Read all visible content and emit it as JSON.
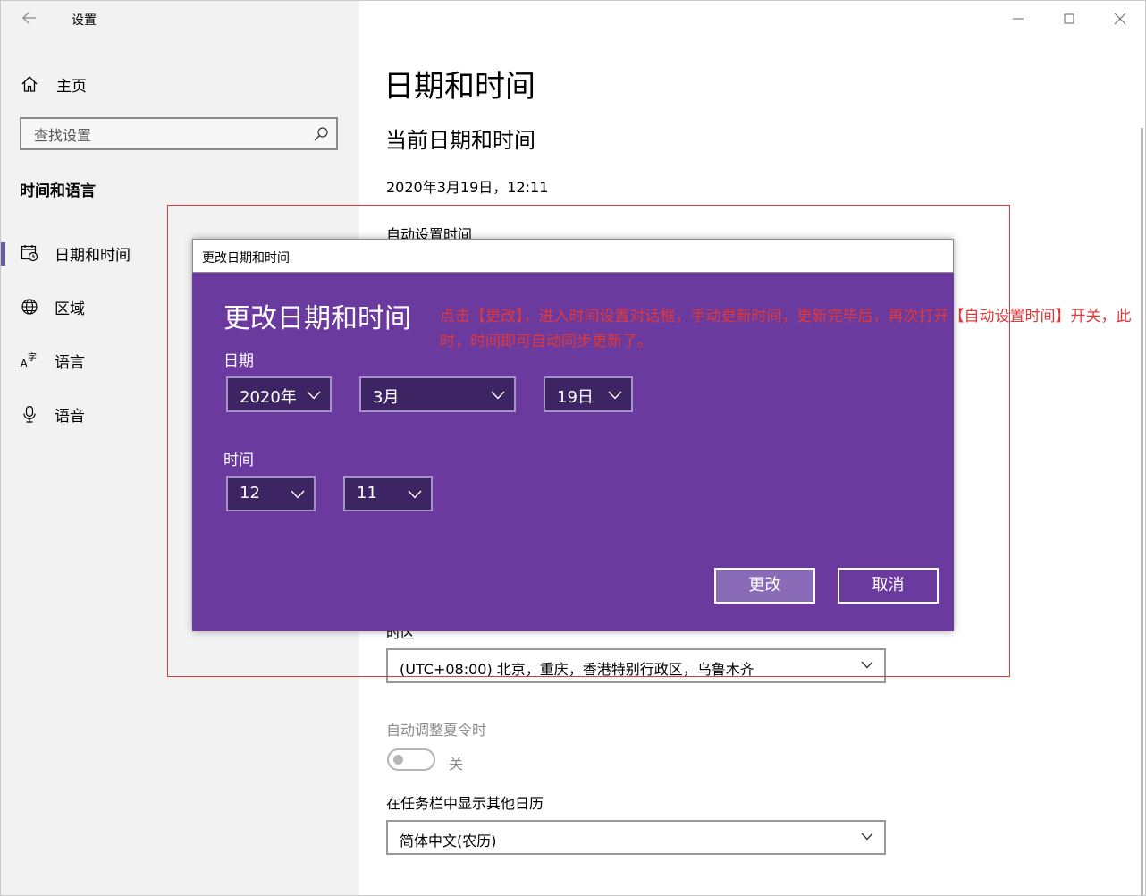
{
  "window": {
    "app_title": "设置",
    "back_icon": "back-arrow-icon",
    "controls": [
      "minimize-icon",
      "maximize-icon",
      "close-icon"
    ]
  },
  "sidebar": {
    "home_label": "主页",
    "search_placeholder": "查找设置",
    "section_title": "时间和语言",
    "items": [
      {
        "label": "日期和时间",
        "icon": "calendar-clock-icon",
        "active": true
      },
      {
        "label": "区域",
        "icon": "globe-icon",
        "active": false
      },
      {
        "label": "语言",
        "icon": "language-icon",
        "active": false
      },
      {
        "label": "语音",
        "icon": "microphone-icon",
        "active": false
      }
    ]
  },
  "main": {
    "title": "日期和时间",
    "subtitle": "当前日期和时间",
    "current_datetime": "2020年3月19日，12:11",
    "auto_time_label": "自动设置时间",
    "timezone_label": "时区",
    "timezone_value": "(UTC+08:00) 北京，重庆，香港特别行政区，乌鲁木齐",
    "dst_label": "自动调整夏令时",
    "dst_state": "关",
    "calendar_label": "在任务栏中显示其他日历",
    "calendar_value": "简体中文(农历)"
  },
  "dialog": {
    "window_title": "更改日期和时间",
    "heading": "更改日期和时间",
    "date_label": "日期",
    "year": "2020年",
    "month": "3月",
    "day": "19日",
    "time_label": "时间",
    "hour": "12",
    "minute": "11",
    "change_button": "更改",
    "cancel_button": "取消"
  },
  "annotation": "点击【更改】，进入时间设置对话框，手动更新时间，更新完毕后，再次打开【自动设置时间】开关，此时，时间即可自动同步更新了。",
  "colors": {
    "dialog_bg": "#6a3a9e",
    "dialog_select_bg": "#3d2463",
    "accent": "#6b5ba0",
    "annotation": "#e0393a"
  }
}
